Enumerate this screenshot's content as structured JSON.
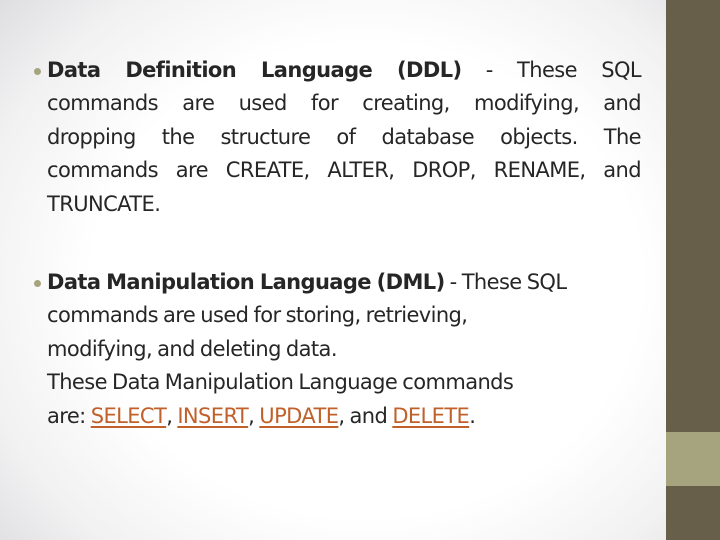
{
  "colors": {
    "sidebar": "#675f49",
    "sidebar_band": "#a6a47e",
    "bullet": "#a6a47e",
    "text": "#262626",
    "link": "#c0602a"
  },
  "bullets": [
    {
      "term": "Data Definition Language (DDL)",
      "lines": [
        {
          "bold": "Data Definition Language (DDL)",
          "rest": " - These SQL"
        },
        {
          "text": "commands are used for creating, modifying, and"
        },
        {
          "text": "dropping the structure of database objects. The"
        },
        {
          "text": "commands are CREATE, ALTER, DROP, RENAME, and"
        },
        {
          "text": "TRUNCATE."
        }
      ]
    },
    {
      "term": "Data Manipulation Language (DML)",
      "lines": [
        {
          "bold": "Data Manipulation Language (DML)",
          "rest": " - These SQL"
        },
        {
          "text": "commands are used for storing, retrieving,"
        },
        {
          "text": "modifying, and deleting data."
        },
        {
          "text": "These Data Manipulation Language commands"
        }
      ],
      "last_line": {
        "prefix": "are: ",
        "links": [
          "SELECT",
          "INSERT",
          "UPDATE",
          "DELETE"
        ],
        "sep1": ", ",
        "sep2": ", ",
        "sep3": ", and ",
        "suffix": "."
      }
    }
  ]
}
